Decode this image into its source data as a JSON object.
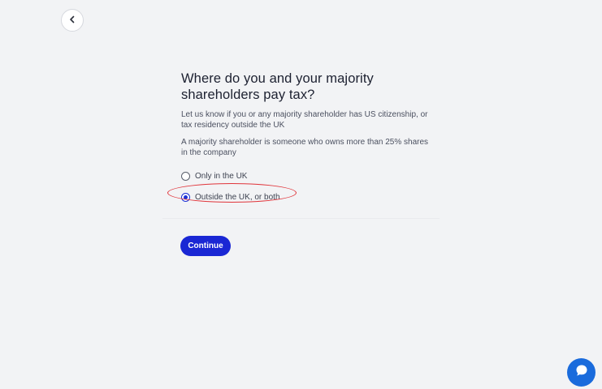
{
  "nav": {
    "back_icon": "chevron-left-icon"
  },
  "question": {
    "title": "Where do you and your majority shareholders pay tax?",
    "description1": "Let us know if you or any majority shareholder has US citizenship, or tax residency outside the UK",
    "description2": "A majority shareholder is someone who owns more than 25% shares in the company"
  },
  "options": [
    {
      "label": "Only in the UK",
      "selected": false
    },
    {
      "label": "Outside the UK, or both",
      "selected": true
    }
  ],
  "actions": {
    "continue_label": "Continue"
  },
  "chat": {
    "icon": "chat-bubble-icon"
  },
  "colors": {
    "accent": "#1a27d4",
    "chat": "#1a6bdc",
    "highlight": "#e0343a",
    "background": "#f2f3f5"
  }
}
